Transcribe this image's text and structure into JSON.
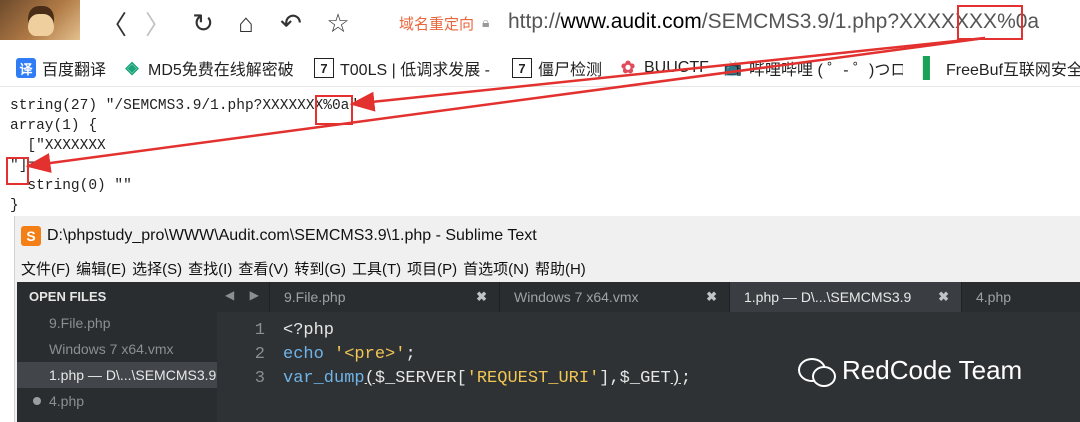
{
  "browser": {
    "nav": {
      "back": "〈",
      "forward": "〉",
      "reload": "↻",
      "home": "⌂",
      "undo": "↶",
      "star": "☆"
    },
    "redirect_label": "域名重定向",
    "url_prefix": "http://",
    "url_domain": "www.audit.com",
    "url_path": "/SEMCMS3.9/1.php?XXXXXXX",
    "url_suffix": "%0a",
    "bookmarks": [
      {
        "icon": "译",
        "label": "百度翻译"
      },
      {
        "icon": "◈",
        "label": "MD5免费在线解密破"
      },
      {
        "icon": "7",
        "label": "T00LS | 低调求发展 -"
      },
      {
        "icon": "7",
        "label": "僵尸检测"
      },
      {
        "icon": "✿",
        "label": "BUUCTF"
      },
      {
        "icon": "📺",
        "label": "哔哩哔哩 ( ゜- ゜)つロ"
      },
      {
        "icon": "▌",
        "label": "FreeBuf互联网安全"
      }
    ]
  },
  "output": {
    "lines": [
      "string(27) \"/SEMCMS3.9/1.php?XXXXXXX%0a\"",
      "array(1) {",
      "  [\"XXXXXXX",
      "\"]=>",
      "  string(0) \"\"",
      "}"
    ]
  },
  "sublime": {
    "title": "D:\\phpstudy_pro\\WWW\\Audit.com\\SEMCMS3.9\\1.php - Sublime Text",
    "logo": "S",
    "menu": [
      "文件(F)",
      "编辑(E)",
      "选择(S)",
      "查找(I)",
      "查看(V)",
      "转到(G)",
      "工具(T)",
      "项目(P)",
      "首选项(N)",
      "帮助(H)"
    ],
    "sidebar_header": "OPEN FILES",
    "open_files": [
      "9.File.php",
      "Windows 7 x64.vmx",
      "1.php — D\\...\\SEMCMS3.9",
      "4.php"
    ],
    "tab_arrows": "◀ ▶",
    "tabs": [
      "9.File.php",
      "Windows 7 x64.vmx",
      "1.php — D\\...\\SEMCMS3.9",
      "4.php"
    ],
    "tab_close": "✖",
    "line_numbers": [
      "1",
      "2",
      "3"
    ],
    "code": {
      "l1": "<?php",
      "l2_kw": "echo",
      "l2_str": "'<pre>'",
      "l2_end": ";",
      "l3_kw": "var_dump",
      "l3_a": "(",
      "l3_b": "$_SERVER[",
      "l3_str": "'REQUEST_URI'",
      "l3_c": "],$_GET",
      "l3_d": ")",
      "l3_e": ";"
    },
    "watermark": "RedCode Team"
  },
  "colors": {
    "annotation": "#e2312e",
    "sublime_bg": "#2f3234",
    "keyword": "#6fb4e8",
    "string": "#f1c654"
  }
}
